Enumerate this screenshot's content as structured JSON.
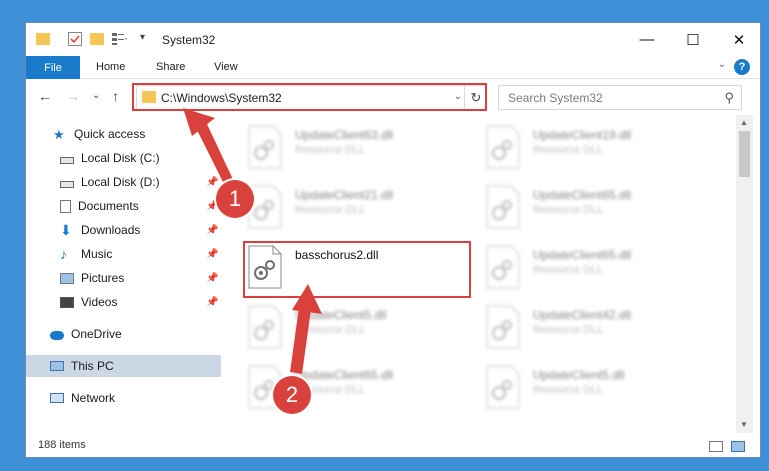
{
  "window": {
    "title": "System32"
  },
  "ribbon": {
    "file_label": "File",
    "tabs": [
      "Home",
      "Share",
      "View"
    ],
    "help": "?"
  },
  "address": {
    "path": "C:\\Windows\\System32",
    "search_placeholder": "Search System32"
  },
  "sidebar": {
    "items": [
      {
        "label": "Quick access",
        "icon": "star-icon"
      },
      {
        "label": "Local Disk (C:)",
        "icon": "drive-icon",
        "pinned": false
      },
      {
        "label": "Local Disk (D:)",
        "icon": "drive-icon",
        "pinned": true
      },
      {
        "label": "Documents",
        "icon": "documents-icon",
        "pinned": true
      },
      {
        "label": "Downloads",
        "icon": "download-icon",
        "pinned": true
      },
      {
        "label": "Music",
        "icon": "music-icon",
        "pinned": true
      },
      {
        "label": "Pictures",
        "icon": "pictures-icon",
        "pinned": true
      },
      {
        "label": "Videos",
        "icon": "videos-icon",
        "pinned": true
      },
      {
        "label": "OneDrive",
        "icon": "cloud-icon"
      },
      {
        "label": "This PC",
        "icon": "computer-icon",
        "selected": true
      },
      {
        "label": "Network",
        "icon": "network-icon"
      }
    ]
  },
  "files": {
    "left": [
      {
        "name": "UpdateClient63.dll",
        "type": "Resource DLL"
      },
      {
        "name": "UpdateClient21.dll",
        "type": "Resource DLL"
      },
      {
        "name": "basschorus2.dll",
        "type": ""
      },
      {
        "name": "UpdateClient5.dll",
        "type": "Resource DLL"
      },
      {
        "name": "UpdateClient65.dll",
        "type": "Resource DLL"
      }
    ],
    "right": [
      {
        "name": "UpdateClient19.dll",
        "type": "Resource DLL"
      },
      {
        "name": "UpdateClient65.dll",
        "type": "Resource DLL"
      },
      {
        "name": "UpdateClient65.dll",
        "type": "Resource DLL"
      },
      {
        "name": "UpdateClient42.dll",
        "type": "Resource DLL"
      },
      {
        "name": "UpdateClient5.dll",
        "type": "Resource DLL"
      }
    ]
  },
  "status": {
    "item_count": "188 items"
  },
  "annotations": {
    "step1": "1",
    "step2": "2"
  },
  "colors": {
    "accent": "#1979ca",
    "highlight": "#d9413c",
    "desktop": "#3f8fd6"
  }
}
